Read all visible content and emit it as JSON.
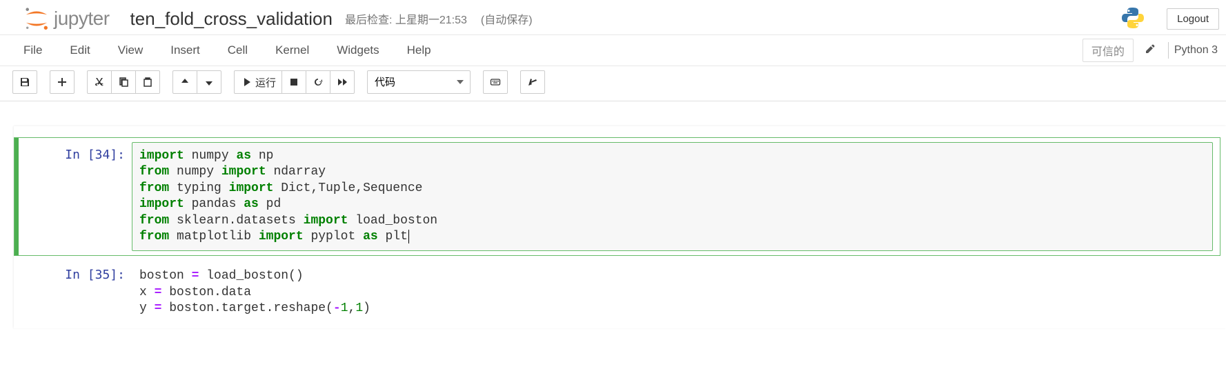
{
  "header": {
    "logo_text": "jupyter",
    "notebook_name": "ten_fold_cross_validation",
    "checkpoint": "最后检查: 上星期一21:53",
    "autosave": "(自动保存)",
    "logout": "Logout"
  },
  "menubar": {
    "items": [
      "File",
      "Edit",
      "View",
      "Insert",
      "Cell",
      "Kernel",
      "Widgets",
      "Help"
    ],
    "trusted": "可信的",
    "kernel": "Python 3"
  },
  "toolbar": {
    "run_label": "运行",
    "celltype_selected": "代码"
  },
  "cells": [
    {
      "prompt": "In [34]:",
      "selected": true,
      "code_plain": "import numpy as np\nfrom numpy import ndarray\nfrom typing import Dict,Tuple,Sequence\nimport pandas as pd\nfrom sklearn.datasets import load_boston\nfrom matplotlib import pyplot as plt"
    },
    {
      "prompt": "In [35]:",
      "selected": false,
      "code_plain": "boston = load_boston()\nx = boston.data\ny = boston.target.reshape(-1,1)"
    }
  ]
}
